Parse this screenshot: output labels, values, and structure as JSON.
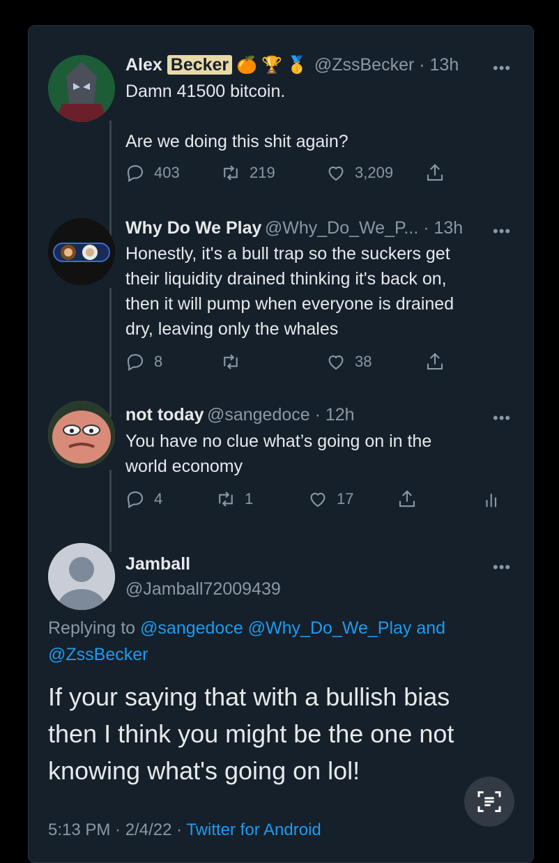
{
  "tweets": [
    {
      "name_first": "Alex",
      "name_second": "Becker",
      "badges": [
        "🍊",
        "🏆",
        "🥇"
      ],
      "handle_time": "@ZssBecker · 13h",
      "text_line1": "Damn 41500 bitcoin.",
      "text_line2": "Are we doing this shit again?",
      "replies": "403",
      "retweets": "219",
      "likes": "3,209",
      "more": "•••"
    },
    {
      "name": "Why Do We Play",
      "handle_time": "@Why_Do_We_P... · 13h",
      "text": "Honestly, it's a bull trap so the suckers get\ntheir liquidity drained thinking it's back on,\nthen it will pump when everyone is drained\ndry, leaving only the whales",
      "replies": "8",
      "retweets": "",
      "likes": "38",
      "more": "•••"
    },
    {
      "name": "not today",
      "handle_time": "@sangedoce · 12h",
      "text": "You have no clue what’s going on in the\nworld economy",
      "replies": "4",
      "retweets": "1",
      "likes": "17",
      "more": "•••"
    }
  ],
  "focus": {
    "name": "Jamball",
    "handle": "@Jamball72009439",
    "replying_to_label": "Replying to",
    "replying_to_users": "@sangedoce @Why_Do_We_Play and",
    "replying_to_users_2": "@ZssBecker",
    "text_line1": "If your saying that with a bullish bias",
    "text_line2": "then I think you might be the one not",
    "text_line3": "knowing what's going on lol!",
    "time_date": "5:13 PM · 2/4/22 ·",
    "source": "Twitter for Android",
    "more": "•••"
  },
  "icons": {
    "reply": "reply-icon",
    "retweet": "retweet-icon",
    "like": "heart-icon",
    "share": "share-icon",
    "analytics": "analytics-icon",
    "scan": "scan-text-icon"
  },
  "colors": {
    "background": "#15202b",
    "text": "#e7e9ea",
    "muted": "#8b98a5",
    "link": "#1d9bf0"
  }
}
